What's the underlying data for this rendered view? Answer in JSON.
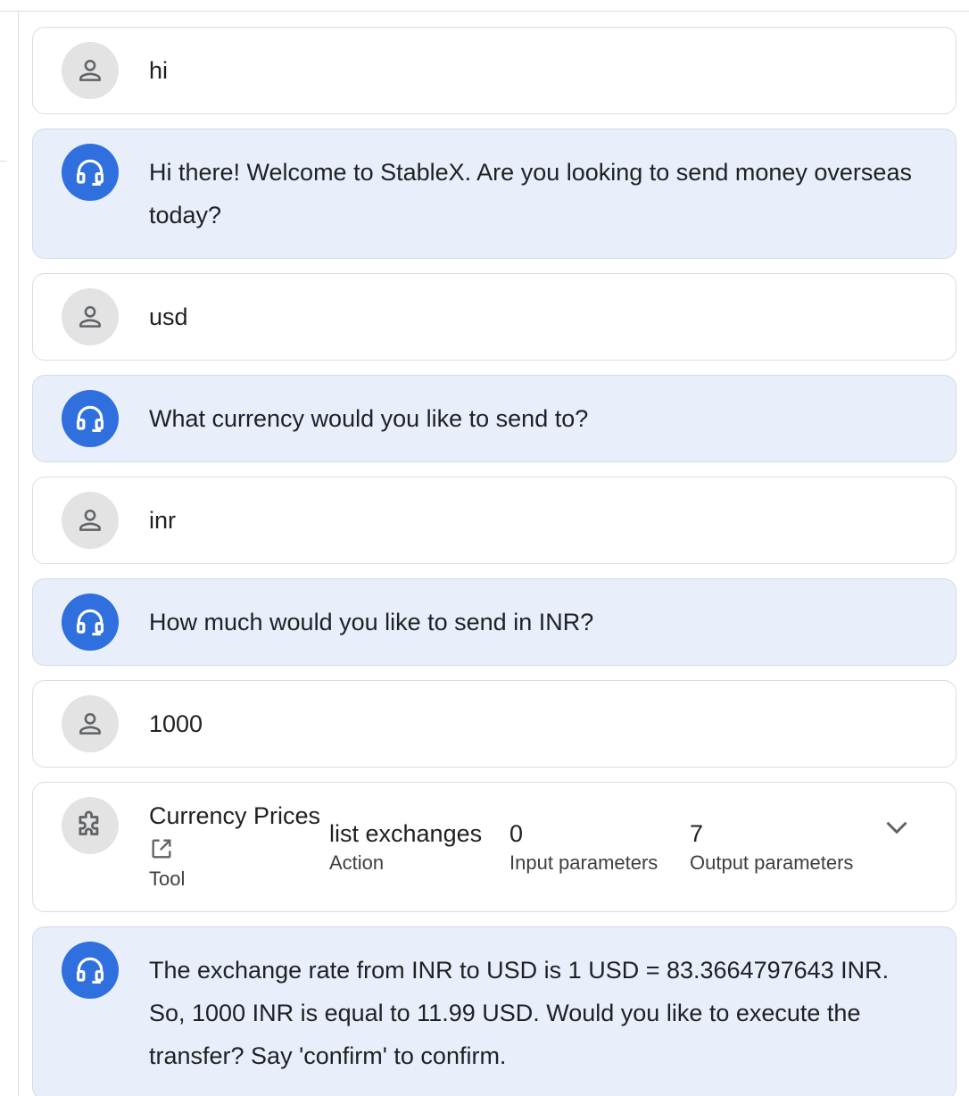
{
  "messages": [
    {
      "role": "user",
      "text": "hi"
    },
    {
      "role": "agent",
      "text": "Hi there! Welcome to StableX. Are you looking to send money overseas today?"
    },
    {
      "role": "user",
      "text": "usd"
    },
    {
      "role": "agent",
      "text": "What currency would you like to send to?"
    },
    {
      "role": "user",
      "text": "inr"
    },
    {
      "role": "agent",
      "text": "How much would you like to send in INR?"
    },
    {
      "role": "user",
      "text": "1000"
    }
  ],
  "tool_call": {
    "name": "Currency Prices",
    "type_label": "Tool",
    "action_value": "list exchanges",
    "action_label": "Action",
    "input_value": "0",
    "input_label": "Input parameters",
    "output_value": "7",
    "output_label": "Output parameters",
    "icon": "puzzle-icon",
    "open_icon": "open-in-new-icon",
    "expand_icon": "chevron-down-icon"
  },
  "final_message": {
    "role": "agent",
    "text": "The exchange rate from INR to USD is 1 USD = 83.3664797643 INR. So, 1000 INR is equal to 11.99 USD. Would you like to execute the transfer? Say 'confirm' to confirm."
  },
  "colors": {
    "agent_bubble": "#e8effb",
    "agent_avatar": "#2f6fde",
    "user_avatar": "#e3e3e3",
    "border": "#dadce0"
  }
}
